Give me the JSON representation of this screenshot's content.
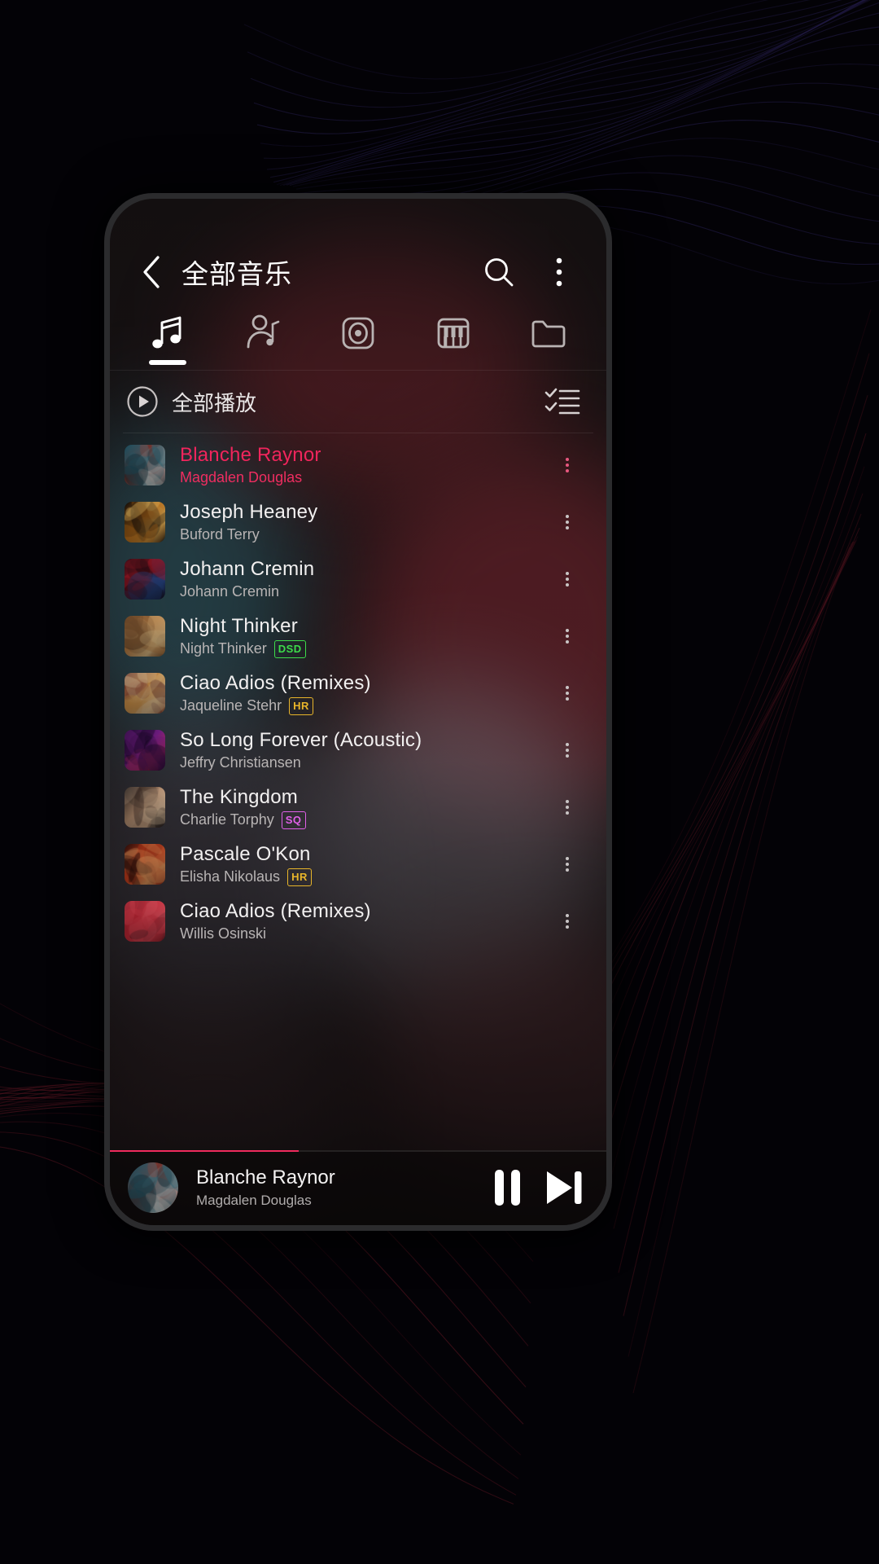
{
  "app": {
    "header": {
      "title": "全部音乐",
      "back_icon": "chevron-left-icon",
      "search_icon": "search-icon",
      "overflow_icon": "more-vertical-icon"
    },
    "tabs": [
      {
        "name": "songs",
        "icon": "music-note-icon",
        "active": true
      },
      {
        "name": "artists",
        "icon": "artist-icon",
        "active": false
      },
      {
        "name": "albums",
        "icon": "album-disc-icon",
        "active": false
      },
      {
        "name": "genres",
        "icon": "piano-keys-icon",
        "active": false
      },
      {
        "name": "folders",
        "icon": "folder-icon",
        "active": false
      }
    ],
    "play_all": {
      "label": "全部播放",
      "play_icon": "play-circle-icon",
      "select_icon": "checklist-icon"
    },
    "songs": [
      {
        "title": "Blanche Raynor",
        "artist": "Magdalen Douglas",
        "badge": "",
        "playing": true,
        "art": [
          "#12313f",
          "#d8452f",
          "#e8e3e0",
          "#2a7f94"
        ]
      },
      {
        "title": "Joseph Heaney",
        "artist": "Buford Terry",
        "badge": "",
        "playing": false,
        "art": [
          "#0b0909",
          "#c9761c",
          "#f0c063",
          "#2a1b10"
        ]
      },
      {
        "title": "Johann Cremin",
        "artist": "Johann Cremin",
        "badge": "",
        "playing": false,
        "art": [
          "#2b0d16",
          "#c51e2e",
          "#2a4b8f",
          "#140810"
        ]
      },
      {
        "title": "Night Thinker",
        "artist": "Night Thinker",
        "badge": "DSD",
        "playing": false,
        "art": [
          "#3d2a1c",
          "#c6874a",
          "#e8c48a",
          "#6b4426"
        ]
      },
      {
        "title": "Ciao Adios (Remixes)",
        "artist": "Jaqueline Stehr",
        "badge": "HR",
        "playing": false,
        "art": [
          "#5b2326",
          "#d89a4e",
          "#e8c89c",
          "#8c3b2a"
        ]
      },
      {
        "title": "So Long Forever (Acoustic)",
        "artist": "Jeffry Christiansen",
        "badge": "",
        "playing": false,
        "art": [
          "#1a0b2e",
          "#7b1f8f",
          "#d0356b",
          "#10061f"
        ]
      },
      {
        "title": "The Kingdom",
        "artist": "Charlie Torphy",
        "badge": "SQ",
        "playing": false,
        "art": [
          "#120e10",
          "#c49a7a",
          "#e8c9a8",
          "#3a2a24"
        ]
      },
      {
        "title": "Pascale O'Kon",
        "artist": "Elisha Nikolaus",
        "badge": "HR",
        "playing": false,
        "art": [
          "#2a0d0a",
          "#d6431f",
          "#f0a060",
          "#601a10"
        ]
      },
      {
        "title": "Ciao Adios (Remixes)",
        "artist": "Willis Osinski",
        "badge": "",
        "playing": false,
        "art": [
          "#1c0a10",
          "#d02a3a",
          "#f05a68",
          "#3a1018"
        ]
      }
    ],
    "badge_colors": {
      "DSD": "#3ddc4a",
      "HR": "#e8b52a",
      "SQ": "#e060e8"
    },
    "now_playing": {
      "title": "Blanche Raynor",
      "artist": "Magdalen Douglas",
      "pause_icon": "pause-icon",
      "next_icon": "skip-next-icon",
      "progress_percent": 38,
      "art": [
        "#12313f",
        "#d8452f",
        "#e8e3e0",
        "#2a7f94"
      ]
    },
    "theme": {
      "accent": "#ef2b5d",
      "text_primary": "#f2f0f0",
      "text_secondary": "#b8b4b4"
    }
  }
}
